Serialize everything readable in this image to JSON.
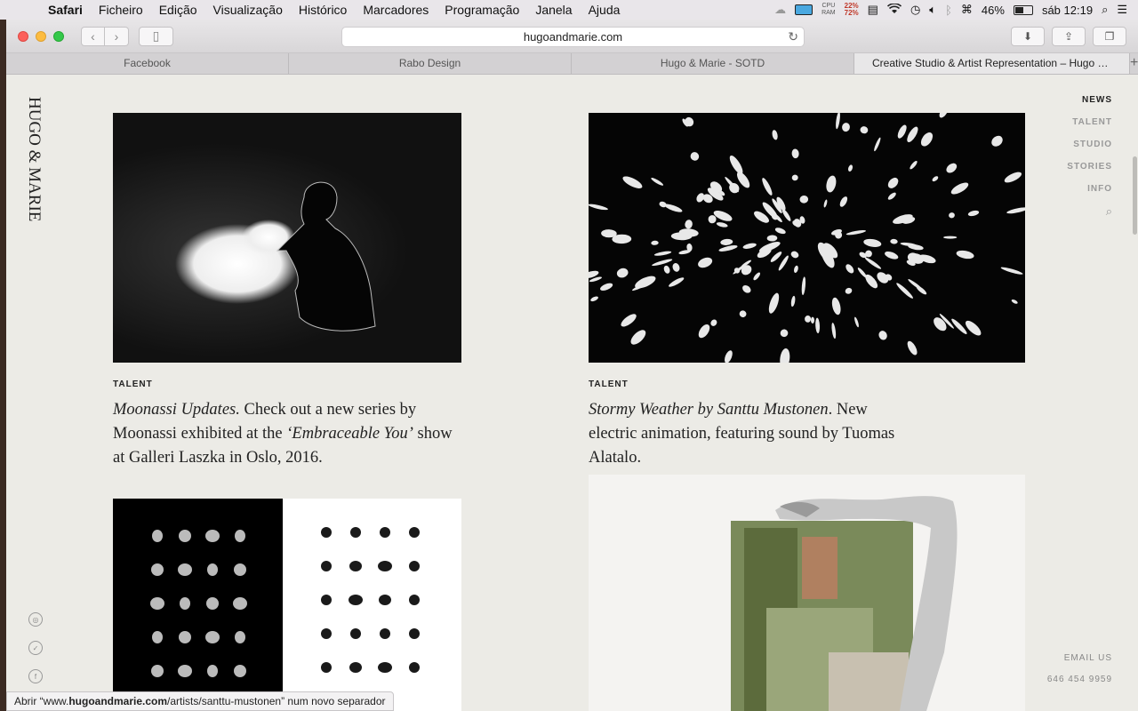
{
  "menubar": {
    "app": "Safari",
    "items": [
      "Ficheiro",
      "Edição",
      "Visualização",
      "Histórico",
      "Marcadores",
      "Programação",
      "Janela",
      "Ajuda"
    ],
    "cpu_label": "CPU",
    "ram_label": "RAM",
    "cpu_pct": "22%",
    "ram_pct": "72%",
    "battery": "46%",
    "clock": "sáb 12:19"
  },
  "browser": {
    "url": "hugoandmarie.com",
    "tabs": [
      "Facebook",
      "Rabo Design",
      "Hugo & Marie - SOTD",
      "Creative Studio & Artist Representation – Hugo &..."
    ],
    "active_tab": 3
  },
  "site": {
    "logo": "HUGO & MARIE",
    "nav": [
      "NEWS",
      "TALENT",
      "STUDIO",
      "STORIES",
      "INFO"
    ],
    "contact_email": "EMAIL US",
    "contact_phone": "646 454 9959",
    "cards": [
      {
        "category": "TALENT",
        "title": "Moonassi Updates.",
        "text": " Check out a new series by Moonassi exhibited at the ",
        "italic2": "‘Embraceable You’",
        "text2": " show at Galleri Laszka in Oslo, 2016."
      },
      {
        "category": "TALENT",
        "title": "Stormy Weather by Santtu Mustonen",
        "text": ". New electric animation, featuring sound by Tuomas Alatalo."
      }
    ]
  },
  "status": {
    "prefix": "Abrir “www.",
    "domain": "hugoandmarie.com",
    "path": "/artists/santtu-mustonen” num novo separador"
  },
  "icons": {
    "apple": "apple-icon",
    "wifi": "wifi-icon",
    "search": "search-icon",
    "instagram": "instagram-icon",
    "twitter": "twitter-icon",
    "facebook": "facebook-icon"
  }
}
